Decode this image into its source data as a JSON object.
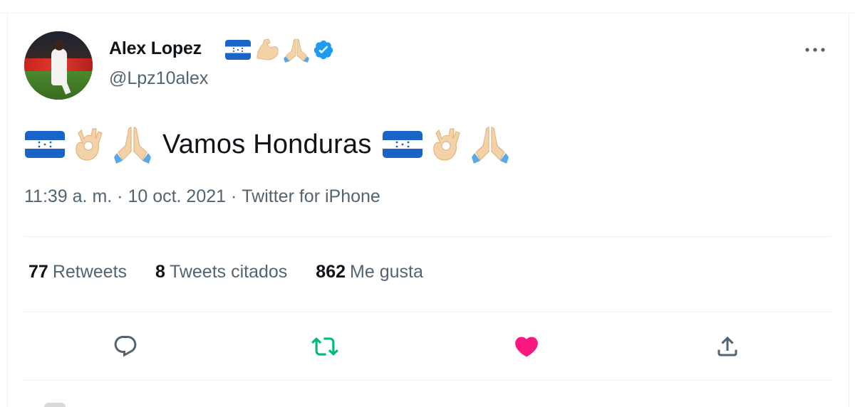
{
  "tweet": {
    "author": {
      "name": "Alex Lopez",
      "handle": "@Lpz10alex",
      "name_emojis": [
        "flag-honduras-icon",
        "flexed-biceps-icon",
        "folded-hands-icon"
      ],
      "verified": true
    },
    "text": "Vamos Honduras",
    "text_emojis_before": [
      "flag-honduras-icon",
      "ok-hand-icon",
      "folded-hands-icon"
    ],
    "text_emojis_after": [
      "flag-honduras-icon",
      "ok-hand-icon",
      "folded-hands-icon"
    ],
    "meta": {
      "time": "11:39 a. m.",
      "separator": " · ",
      "date": "10 oct. 2021",
      "source": "Twitter for iPhone"
    },
    "stats": {
      "retweets_count": "77",
      "retweets_label": "Retweets",
      "quotes_count": "8",
      "quotes_label": "Tweets citados",
      "likes_count": "862",
      "likes_label": "Me gusta"
    },
    "actions": [
      "reply-icon",
      "retweet-icon",
      "like-icon",
      "share-icon"
    ]
  },
  "colors": {
    "text_primary": "#0f1419",
    "text_secondary": "#536471",
    "divider": "#eff3f4",
    "verified_blue": "#1d9bf0",
    "retweet_green": "#00ba7c",
    "like_pink": "#f91880",
    "flag_blue": "#1a64c8"
  }
}
